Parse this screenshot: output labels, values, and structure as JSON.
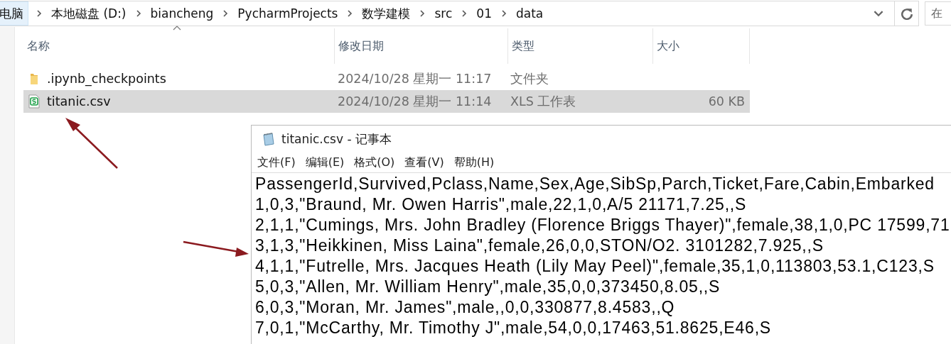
{
  "address_bar": {
    "segments": [
      "电脑",
      "本地磁盘 (D:)",
      "biancheng",
      "PycharmProjects",
      "数学建模",
      "src",
      "01",
      "data"
    ],
    "search_placeholder": "在"
  },
  "file_list": {
    "columns": [
      {
        "label": "名称",
        "sorted": true
      },
      {
        "label": "修改日期",
        "sorted": false
      },
      {
        "label": "类型",
        "sorted": false
      },
      {
        "label": "大小",
        "sorted": false
      }
    ],
    "rows": [
      {
        "kind": "folder",
        "name": ".ipynb_checkpoints",
        "modified": "2024/10/28 星期一 11:17",
        "type": "文件夹",
        "size": "",
        "selected": false
      },
      {
        "kind": "spreadsheet",
        "name": "titanic.csv",
        "modified": "2024/10/28 星期一 11:14",
        "type": "XLS 工作表",
        "size": "60 KB",
        "selected": true
      }
    ]
  },
  "notepad": {
    "title": "titanic.csv - 记事本",
    "menu": [
      "文件(F)",
      "编辑(E)",
      "格式(O)",
      "查看(V)",
      "帮助(H)"
    ],
    "lines": [
      "PassengerId,Survived,Pclass,Name,Sex,Age,SibSp,Parch,Ticket,Fare,Cabin,Embarked",
      "1,0,3,\"Braund, Mr. Owen Harris\",male,22,1,0,A/5 21171,7.25,,S",
      "2,1,1,\"Cumings, Mrs. John Bradley (Florence Briggs Thayer)\",female,38,1,0,PC 17599,71",
      "3,1,3,\"Heikkinen, Miss Laina\",female,26,0,0,STON/O2. 3101282,7.925,,S",
      "4,1,1,\"Futrelle, Mrs. Jacques Heath (Lily May Peel)\",female,35,1,0,113803,53.1,C123,S",
      "5,0,3,\"Allen, Mr. William Henry\",male,35,0,0,373450,8.05,,S",
      "6,0,3,\"Moran, Mr. James\",male,,0,0,330877,8.4583,,Q",
      "7,0,1,\"McCarthy, Mr. Timothy J\",male,54,0,0,17463,51.8625,E46,S"
    ]
  }
}
